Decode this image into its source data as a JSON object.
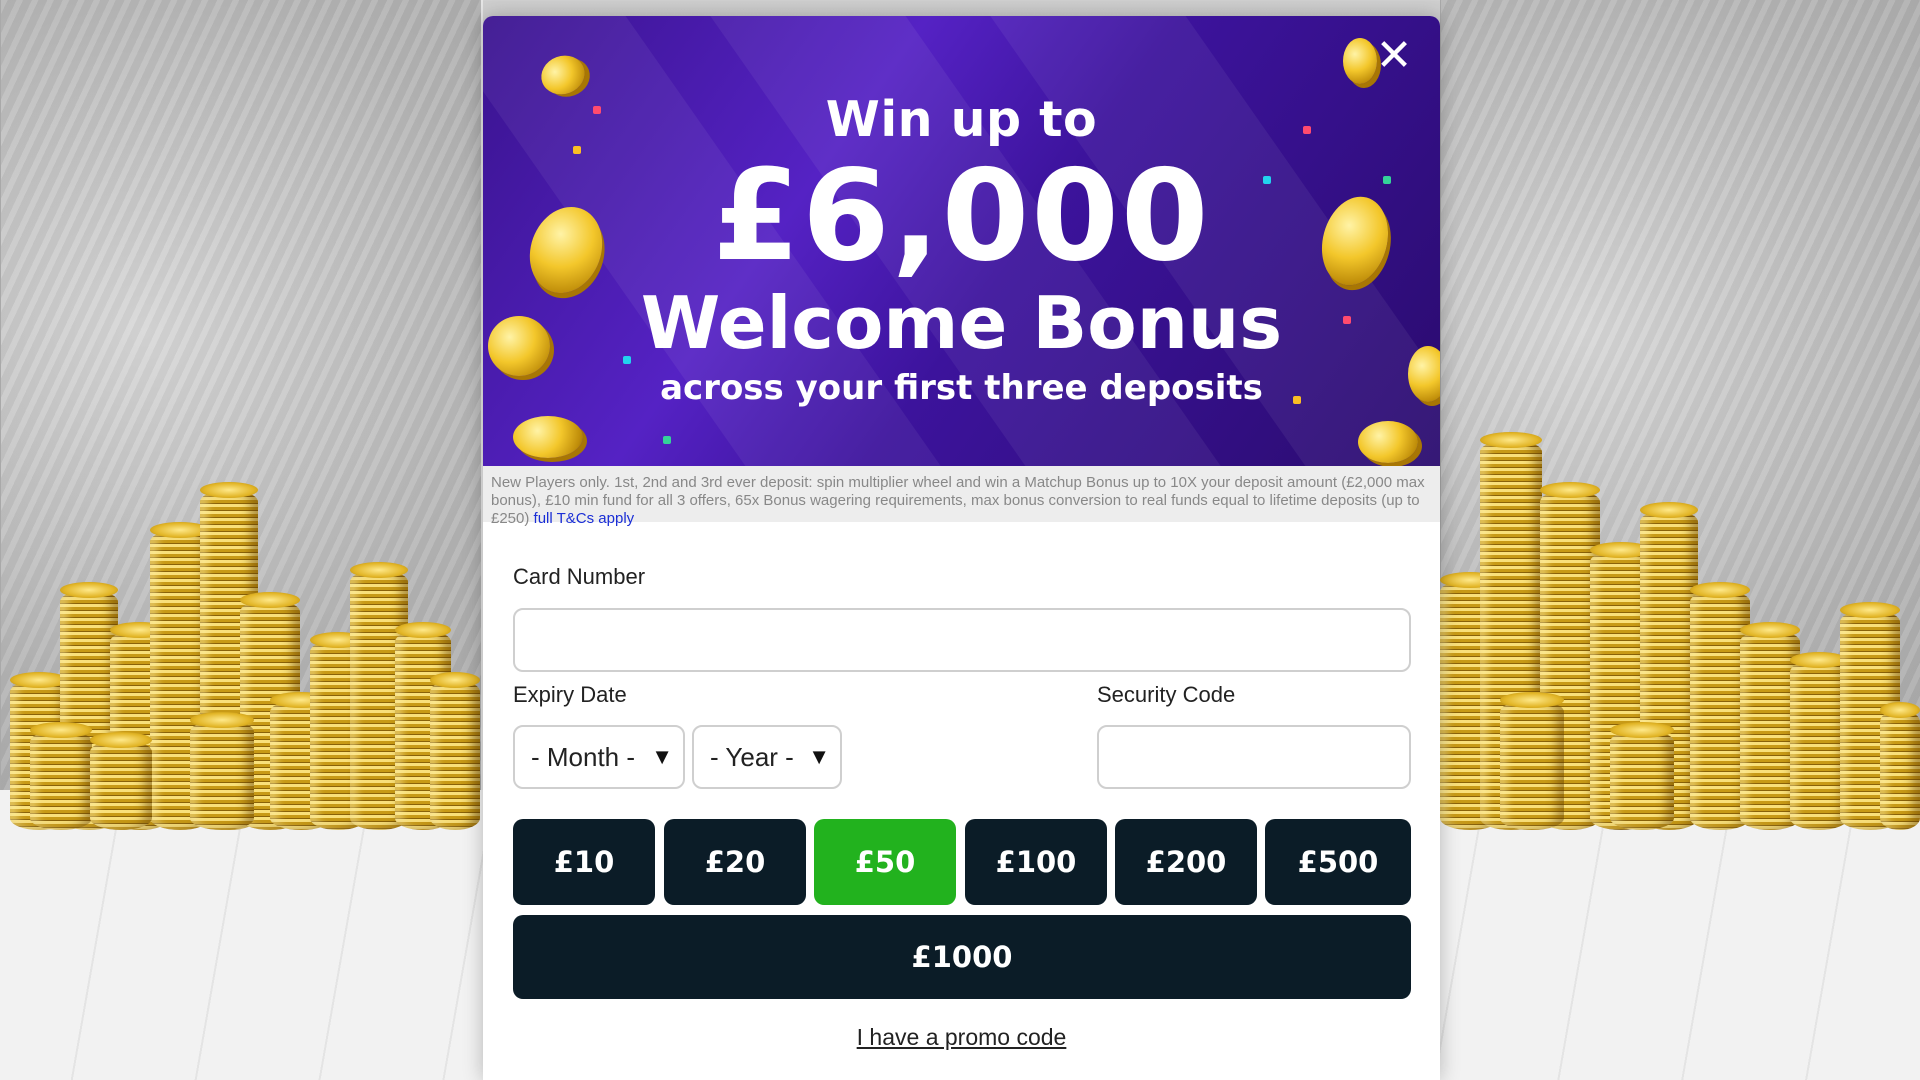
{
  "banner": {
    "line1": "Win up to",
    "line2": "£6,000",
    "line3": "Welcome Bonus",
    "line4": "across your first three deposits",
    "close_icon": "close-icon",
    "colors": {
      "bg": "#3a138f",
      "text": "#ffffff"
    }
  },
  "terms": {
    "text": "New Players only. 1st, 2nd and 3rd ever deposit: spin multiplier wheel and win a Matchup Bonus up to 10X your deposit amount (£2,000 max bonus), £10 min fund for all 3 offers, 65x Bonus wagering requirements, max bonus conversion to real funds equal to lifetime deposits (up to £250)",
    "link": "full T&Cs apply"
  },
  "form": {
    "card_number_label": "Card Number",
    "card_number_value": "",
    "expiry_label": "Expiry Date",
    "month_select": "- Month -",
    "year_select": "- Year -",
    "security_label": "Security Code",
    "security_value": ""
  },
  "amounts": [
    "£10",
    "£20",
    "£50",
    "£100",
    "£200",
    "£500",
    "£1000"
  ],
  "selected_amount": "£50",
  "colors": {
    "amount_bg": "#0b1c27",
    "selected_bg": "#22b21e"
  },
  "promo_link": "I have a promo code"
}
